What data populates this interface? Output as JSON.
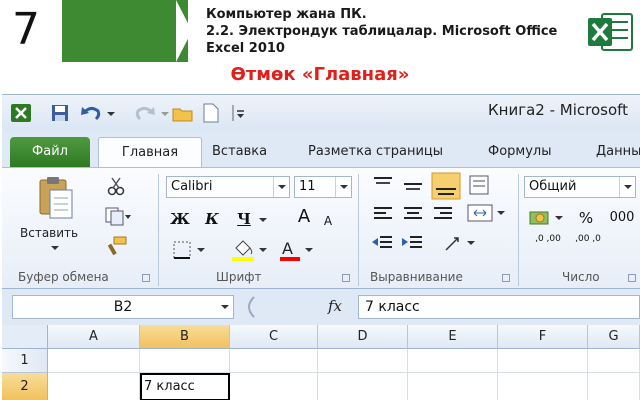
{
  "slide": {
    "grade": "7",
    "header_line1": "Компьютер жана ПК.",
    "header_line2": "2.2. Электрондук таблицалар. Microsoft Office Excel 2010",
    "title": "Өтмөк «Главная»",
    "colors": {
      "green": "#3d8a32",
      "title_red": "#e0201a"
    }
  },
  "excel": {
    "window_title": "Книга2  -  Microsoft",
    "tabs": [
      {
        "label": "Файл"
      },
      {
        "label": "Главная"
      },
      {
        "label": "Вставка"
      },
      {
        "label": "Разметка страницы"
      },
      {
        "label": "Формулы"
      },
      {
        "label": "Данны"
      }
    ],
    "clipboard": {
      "paste_label": "Вставить",
      "group_label": "Буфер обмена"
    },
    "font": {
      "name": "Calibri",
      "size": "11",
      "bold": "Ж",
      "italic": "К",
      "underline": "Ч",
      "grow": "A",
      "shrink": "A",
      "group_label": "Шрифт"
    },
    "alignment": {
      "group_label": "Выравнивание"
    },
    "number": {
      "format": "Общий",
      "percent": "%",
      "thousands": "000",
      "inc_decimal": ",0 ,00",
      "dec_decimal": ",00 ,0",
      "group_label": "Число"
    },
    "formula_bar": {
      "name_box": "B2",
      "fx": "fx",
      "value": "7 класс"
    },
    "columns": [
      "A",
      "B",
      "C",
      "D",
      "E",
      "F",
      "G"
    ],
    "rows": [
      "1",
      "2"
    ],
    "active_cell_value": "7 класс"
  }
}
